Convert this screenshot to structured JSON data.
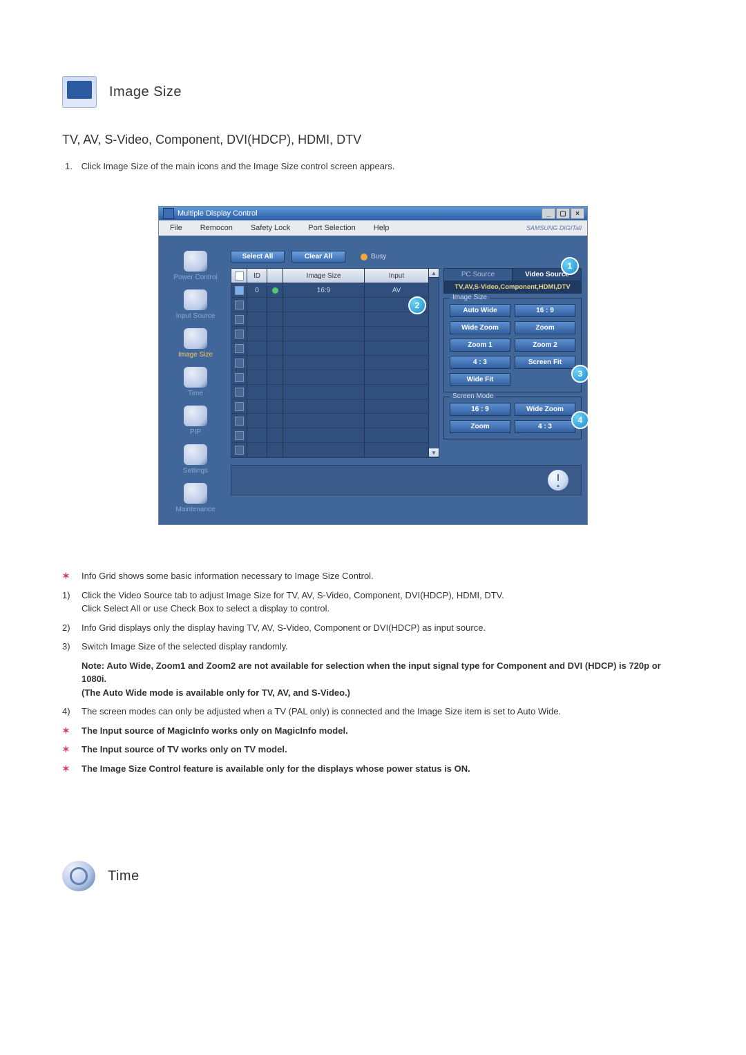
{
  "section1": {
    "title": "Image Size",
    "subtitle": "TV, AV, S-Video, Component, DVI(HDCP), HDMI, DTV",
    "step1_num": "1.",
    "step1_text": "Click Image Size of the main icons and the Image Size control screen appears."
  },
  "app": {
    "title": "Multiple Display Control",
    "menu": {
      "file": "File",
      "remocon": "Remocon",
      "safety": "Safety Lock",
      "port": "Port Selection",
      "help": "Help"
    },
    "brand": "SAMSUNG DIGITall",
    "buttons": {
      "select_all": "Select All",
      "clear_all": "Clear All"
    },
    "busy": "Busy",
    "sidebar": {
      "power": "Power Control",
      "input": "Input Source",
      "image": "Image Size",
      "time": "Time",
      "pip": "PIP",
      "settings": "Settings",
      "maintenance": "Maintenance"
    },
    "grid": {
      "headers": {
        "check": "",
        "id": "ID",
        "stat": "",
        "size": "Image Size",
        "input": "Input"
      },
      "row0": {
        "id": "0",
        "size": "16:9",
        "input": "AV"
      }
    },
    "panel": {
      "tab_pc": "PC Source",
      "tab_video": "Video Source",
      "sources": "TV,AV,S-Video,Component,HDMI,DTV",
      "group_image": "Image Size",
      "btns_image": {
        "b1": "Auto Wide",
        "b2": "16 : 9",
        "b3": "Wide Zoom",
        "b4": "Zoom",
        "b5": "Zoom 1",
        "b6": "Zoom 2",
        "b7": "4 : 3",
        "b8": "Screen Fit",
        "b9": "Wide Fit"
      },
      "group_screen": "Screen Mode",
      "btns_screen": {
        "s1": "16 : 9",
        "s2": "Wide Zoom",
        "s3": "Zoom",
        "s4": "4 : 3"
      }
    },
    "callouts": {
      "c1": "1",
      "c2": "2",
      "c3": "3",
      "c4": "4"
    }
  },
  "notes": {
    "n0": "Info Grid shows some basic information necessary to Image Size Control.",
    "n1a": "Click the Video Source tab to adjust Image Size for TV, AV, S-Video, Component, DVI(HDCP), HDMI, DTV.",
    "n1b": "Click Select All or use Check Box to select a display to control.",
    "n2": "Info Grid displays only the display having TV, AV, S-Video, Component or DVI(HDCP) as input source.",
    "n3": "Switch Image Size of the selected display randomly.",
    "n3_note": "Note: Auto Wide, Zoom1 and Zoom2 are not available for selection when the input signal type for Component and DVI (HDCP) is 720p or 1080i.",
    "n3_paren": "(The Auto Wide mode is available only for TV, AV, and S-Video.)",
    "n4": "The screen modes can only be adjusted when a TV (PAL only) is connected and the Image Size item is set to Auto Wide.",
    "b1": "The Input source of MagicInfo works only on MagicInfo model.",
    "b2": "The Input source of TV works only on TV model.",
    "b3": "The Image Size Control feature is available only for the displays whose power status is ON.",
    "labels": {
      "num1": "1)",
      "num2": "2)",
      "num3": "3)",
      "num4": "4)"
    }
  },
  "section2": {
    "title": "Time"
  }
}
